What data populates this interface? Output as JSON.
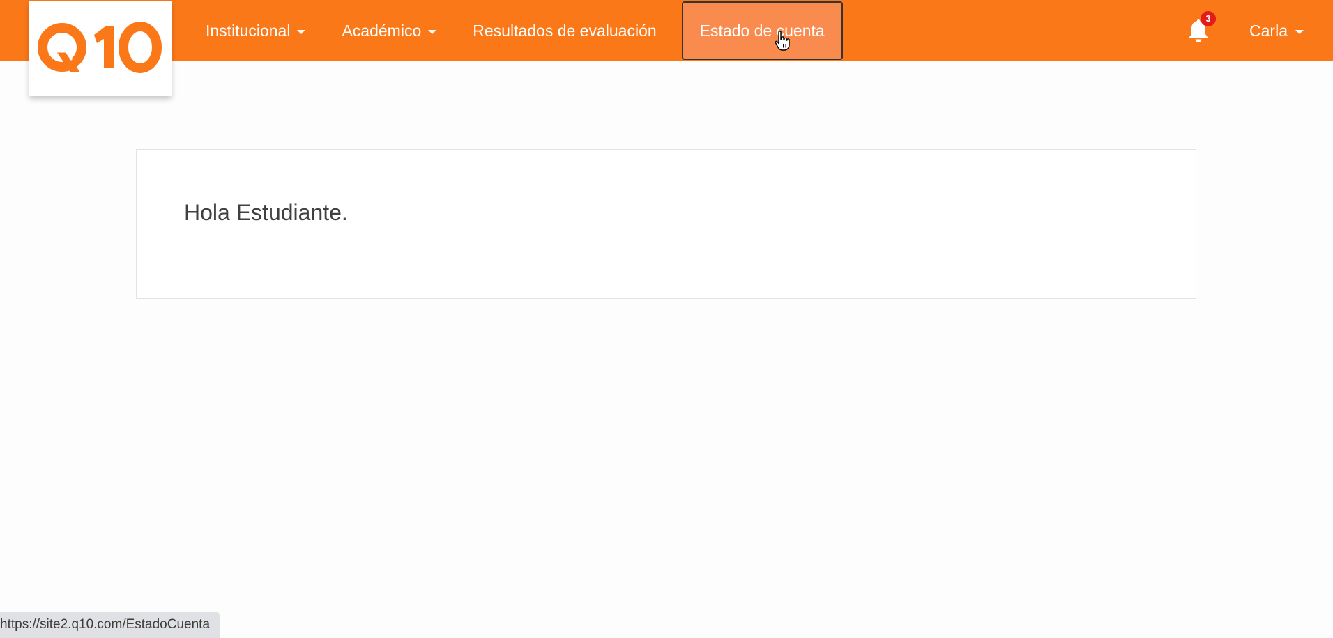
{
  "logo": {
    "text": "Q10",
    "color": "#fb7819"
  },
  "navbar": {
    "background_color": "#fb7819",
    "items": [
      {
        "label": "Institucional",
        "has_dropdown": true
      },
      {
        "label": "Académico",
        "has_dropdown": true
      },
      {
        "label": "Resultados de evaluación",
        "has_dropdown": false
      },
      {
        "label": "Estado de cuenta",
        "has_dropdown": false,
        "active": true
      }
    ]
  },
  "notifications": {
    "icon": "bell-icon",
    "count": "3"
  },
  "user": {
    "name": "Carla"
  },
  "main": {
    "greeting": "Hola Estudiante."
  },
  "statusbar": {
    "url": "https://site2.q10.com/EstadoCuenta"
  }
}
